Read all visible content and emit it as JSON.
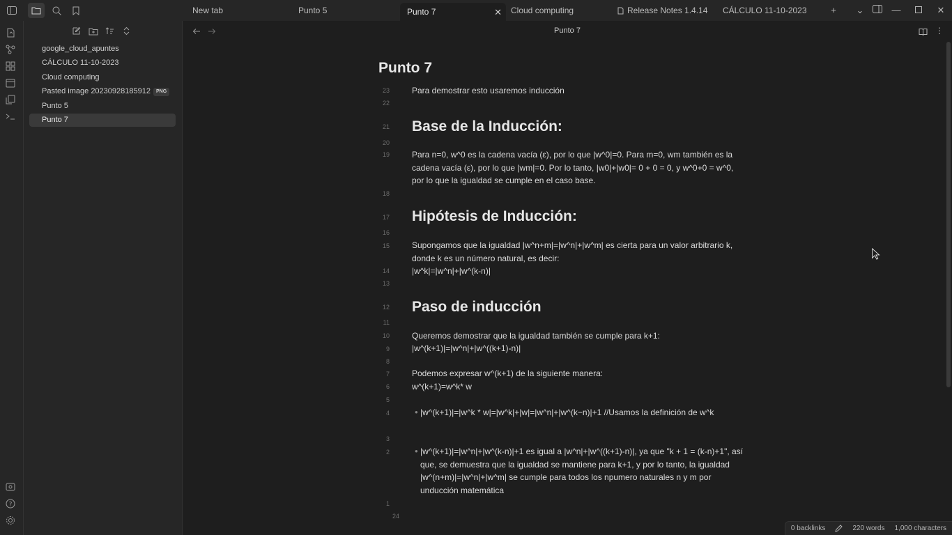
{
  "tabs": [
    {
      "label": "New tab"
    },
    {
      "label": "Punto 5"
    },
    {
      "label": "Punto 7"
    },
    {
      "label": "Cloud computing"
    },
    {
      "label": "Release Notes 1.4.14"
    },
    {
      "label": "CÁLCULO 11-10-2023"
    }
  ],
  "sidebar": {
    "files": [
      {
        "label": "google_cloud_apuntes"
      },
      {
        "label": "CÁLCULO 11-10-2023"
      },
      {
        "label": "Cloud computing"
      },
      {
        "label": "Pasted image 20230928185912",
        "badge": "PNG"
      },
      {
        "label": "Punto 5"
      },
      {
        "label": "Punto 7"
      }
    ]
  },
  "view": {
    "title": "Punto 7"
  },
  "note": {
    "title": "Punto 7",
    "lines": {
      "l23": "23",
      "l22": "22",
      "l21": "21",
      "l20": "20",
      "l19": "19",
      "l18": "18",
      "l17": "17",
      "l16": "16",
      "l15": "15",
      "l14": "14",
      "l13": "13",
      "l12": "12",
      "l11": "11",
      "l10": "10",
      "l9": "9",
      "l8": "8",
      "l7": "7",
      "l6": "6",
      "l5": "5",
      "l4": "4",
      "l3": "3",
      "l2": "2",
      "l1": "1",
      "l24": "24"
    },
    "p_intro": "Para demostrar esto usaremos inducción",
    "h_base": "Base de la Inducción:",
    "p_base": "Para n=0, w^0 es la cadena vacía (ε), por lo que |w^0|=0. Para m=0, wm también es la cadena vacía (ε), por lo que |wm|=0. Por lo tanto, |w0|+|w0|= 0 + 0 = 0, y w^0+0 = w^0, por lo que la igualdad se cumple en el caso base.",
    "h_hip": "Hipótesis de Inducción:",
    "p_hip": "Supongamos que la igualdad |w^n+m|=|w^n|+|w^m| es cierta para un valor arbitrario k, donde k es un número natural, es decir:",
    "p_hip2": "|w^k|=|w^n|+|w^(k-n)|",
    "h_paso": "Paso de inducción",
    "p_paso1": "Queremos demostrar que la igualdad también se cumple para k+1:",
    "p_paso2": "|w^(k+1)|=|w^n|+|w^((k+1)-n)|",
    "p_paso3": "Podemos expresar w^(k+1) de la siguiente manera:",
    "p_paso4": "w^(k+1)=w^k* w",
    "b1": "|w^(k+1)|=|w^k * w|=|w^k|+|w|=|w^n|+|w^(k−n)|+1 //Usamos la definición de w^k",
    "b2": "|w^(k+1)|=|w^n|+|w^(k-n)|+1 es igual a |w^n|+|w^((k+1)-n)|, ya que \"k + 1 = (k-n)+1\", así que, se demuestra que la igualdad se mantiene para k+1, y por lo tanto, la igualdad |w^(n+m)|=|w^n|+|w^m| se cumple para todos los npumero naturales n y m por unducción matemática"
  },
  "status": {
    "backlinks": "0 backlinks",
    "words": "220 words",
    "characters": "1,000 characters"
  },
  "colors": {
    "background": "#1e1e1e",
    "panel": "#262626",
    "text": "#dadada"
  }
}
